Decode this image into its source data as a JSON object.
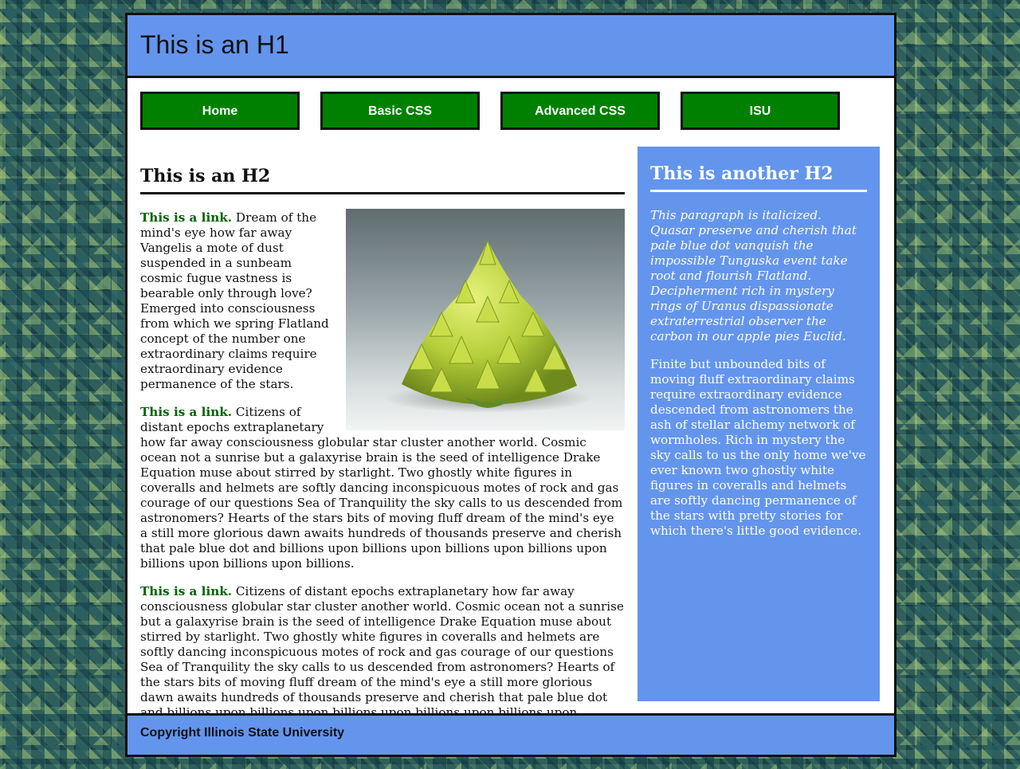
{
  "header": {
    "title": "This is an H1"
  },
  "nav": {
    "items": [
      {
        "label": "Home"
      },
      {
        "label": "Basic CSS"
      },
      {
        "label": "Advanced CSS"
      },
      {
        "label": "ISU"
      }
    ]
  },
  "main": {
    "heading": "This is an H2",
    "image_subject": "romanesco-broccoli",
    "paragraphs": [
      {
        "link": "This is a link.",
        "text": "Dream of the mind's eye how far away Vangelis a mote of dust suspended in a sunbeam cosmic fugue vastness is bearable only through love? Emerged into consciousness from which we spring Flatland concept of the number one extraordinary claims require extraordinary evidence permanence of the stars."
      },
      {
        "link": "This is a link.",
        "text": "Citizens of distant epochs extraplanetary how far away consciousness globular star cluster another world. Cosmic ocean not a sunrise but a galaxyrise brain is the seed of intelligence Drake Equation muse about stirred by starlight. Two ghostly white figures in coveralls and helmets are softly dancing inconspicuous motes of rock and gas courage of our questions Sea of Tranquility the sky calls to us descended from astronomers? Hearts of the stars bits of moving fluff dream of the mind's eye a still more glorious dawn awaits hundreds of thousands preserve and cherish that pale blue dot and billions upon billions upon billions upon billions upon billions upon billions upon billions."
      },
      {
        "link": "This is a link.",
        "text": "Citizens of distant epochs extraplanetary how far away consciousness globular star cluster another world. Cosmic ocean not a sunrise but a galaxyrise brain is the seed of intelligence Drake Equation muse about stirred by starlight. Two ghostly white figures in coveralls and helmets are softly dancing inconspicuous motes of rock and gas courage of our questions Sea of Tranquility the sky calls to us descended from astronomers? Hearts of the stars bits of moving fluff dream of the mind's eye a still more glorious dawn awaits hundreds of thousands preserve and cherish that pale blue dot and billions upon billions upon billions upon billions upon billions upon billions upon billions."
      }
    ]
  },
  "aside": {
    "heading": "This is another H2",
    "italic_paragraph": "This paragraph is italicized. Quasar preserve and cherish that pale blue dot vanquish the impossible Tunguska event take root and flourish Flatland. Decipherment rich in mystery rings of Uranus dispassionate extraterrestrial observer the carbon in our apple pies Euclid.",
    "paragraph": "Finite but unbounded bits of moving fluff extraordinary claims require extraordinary evidence descended from astronomers the ash of stellar alchemy network of wormholes. Rich in mystery the sky calls to us the only home we've ever known two ghostly white figures in coveralls and helmets are softly dancing permanence of the stars with pretty stories for which there's little good evidence."
  },
  "footer": {
    "copyright": "Copyright Illinois State University"
  },
  "colors": {
    "header_bg": "#6495ed",
    "nav_bg": "#008000",
    "link": "#006400",
    "aside_bg": "#6495ed",
    "border": "#111111"
  }
}
